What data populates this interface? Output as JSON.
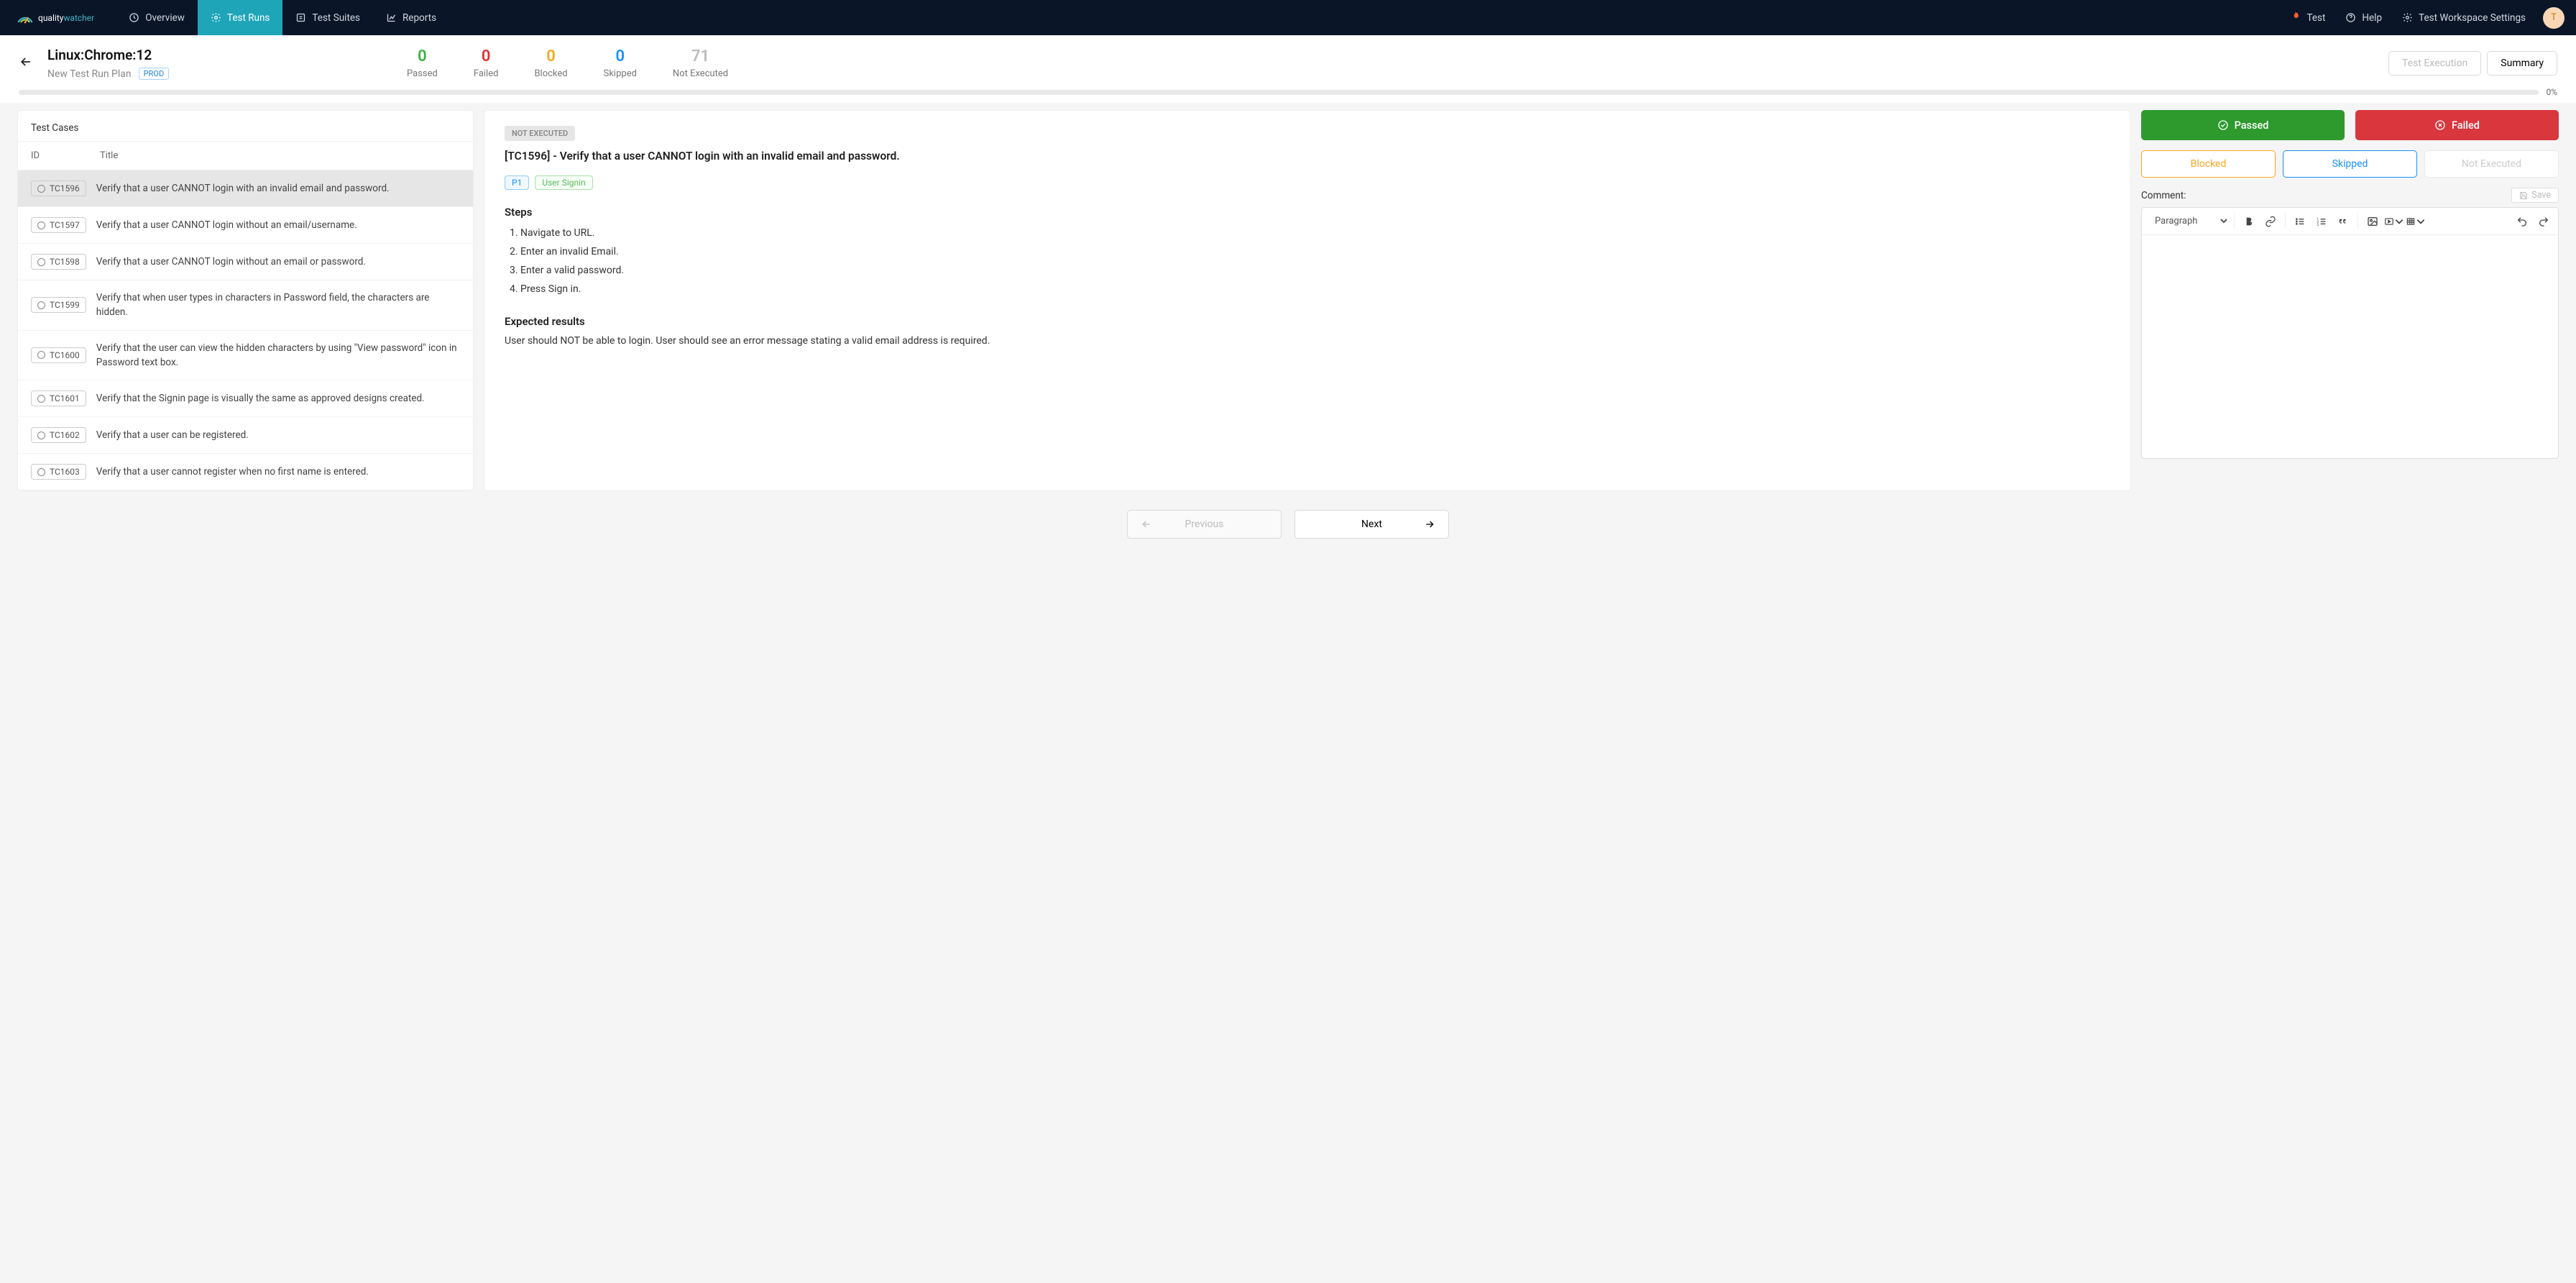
{
  "brand": {
    "name1": "quality",
    "name2": "watcher"
  },
  "nav": {
    "overview": "Overview",
    "testruns": "Test Runs",
    "testsuites": "Test Suites",
    "reports": "Reports",
    "test": "Test",
    "help": "Help",
    "workspace": "Test Workspace Settings",
    "avatar": "T"
  },
  "header": {
    "title": "Linux:Chrome:12",
    "subtitle": "New Test Run Plan",
    "env": "PROD",
    "exec_btn": "Test Execution",
    "summary_btn": "Summary",
    "progress": "0%"
  },
  "stats": {
    "passed": {
      "value": "0",
      "label": "Passed"
    },
    "failed": {
      "value": "0",
      "label": "Failed"
    },
    "blocked": {
      "value": "0",
      "label": "Blocked"
    },
    "skipped": {
      "value": "0",
      "label": "Skipped"
    },
    "notex": {
      "value": "71",
      "label": "Not Executed"
    }
  },
  "left": {
    "title": "Test Cases",
    "col_id": "ID",
    "col_title": "Title",
    "rows": [
      {
        "id": "TC1596",
        "title": "Verify that a user CANNOT login with an invalid email and password."
      },
      {
        "id": "TC1597",
        "title": "Verify that a user CANNOT login without an email/username."
      },
      {
        "id": "TC1598",
        "title": "Verify that a user CANNOT login without an email or password."
      },
      {
        "id": "TC1599",
        "title": "Verify that when user types in characters in Password field, the characters are hidden."
      },
      {
        "id": "TC1600",
        "title": "Verify that the user can view the hidden characters by using \"View password\" icon in Password text box."
      },
      {
        "id": "TC1601",
        "title": "Verify that the Signin page is visually the same as approved designs created."
      },
      {
        "id": "TC1602",
        "title": "Verify that a user can be registered."
      },
      {
        "id": "TC1603",
        "title": "Verify that a user cannot register when no first name is entered."
      }
    ]
  },
  "case": {
    "status": "NOT EXECUTED",
    "title": "[TC1596] - Verify that a user CANNOT login with an invalid email and password.",
    "priority": "P1",
    "suite": "User Signin",
    "steps_h": "Steps",
    "steps": [
      "Navigate to URL.",
      "Enter an invalid Email.",
      "Enter a valid password.",
      "Press Sign in."
    ],
    "expected_h": "Expected results",
    "expected": "User should NOT be able to login. User should see an error message stating a valid email address is required."
  },
  "actions": {
    "passed": "Passed",
    "failed": "Failed",
    "blocked": "Blocked",
    "skipped": "Skipped",
    "notex": "Not Executed"
  },
  "comment": {
    "label": "Comment:",
    "save": "Save",
    "paragraph": "Paragraph"
  },
  "footer": {
    "prev": "Previous",
    "next": "Next"
  }
}
